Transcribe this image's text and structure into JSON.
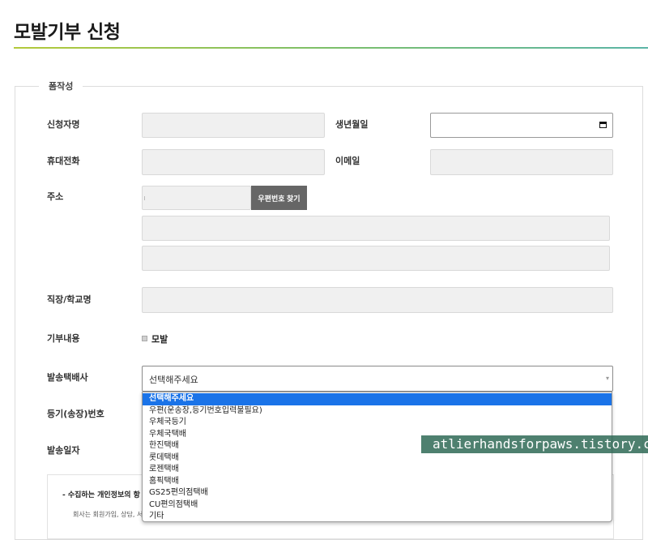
{
  "page": {
    "title": "모발기부 신청"
  },
  "form": {
    "legend": "폼작성",
    "labels": {
      "applicant": "신청자명",
      "birthdate": "생년월일",
      "phone": "휴대전화",
      "email": "이메일",
      "address": "주소",
      "workplace": "직장/학교명",
      "donation": "기부내용",
      "courier": "발송택배사",
      "tracking": "등기(송장)번호",
      "send_date": "발송일자"
    },
    "zip_button": "우편번호 찾기",
    "donation_option": "모발",
    "courier_select": {
      "selected": "선택해주세요",
      "options": [
        "선택해주세요",
        "우편(운송장,등기번호입력불필요)",
        "우체국등기",
        "우체국택배",
        "한진택배",
        "롯데택배",
        "로젠택배",
        "홈픽택배",
        "GS25편의점택배",
        "CU편의점택배",
        "기타"
      ]
    },
    "notice_title": "- 수집하는 개인정보의 항",
    "notice_body": "회사는 회원가입, 상담, 서"
  },
  "watermark": "atlierhandsforpaws.tistory.com"
}
